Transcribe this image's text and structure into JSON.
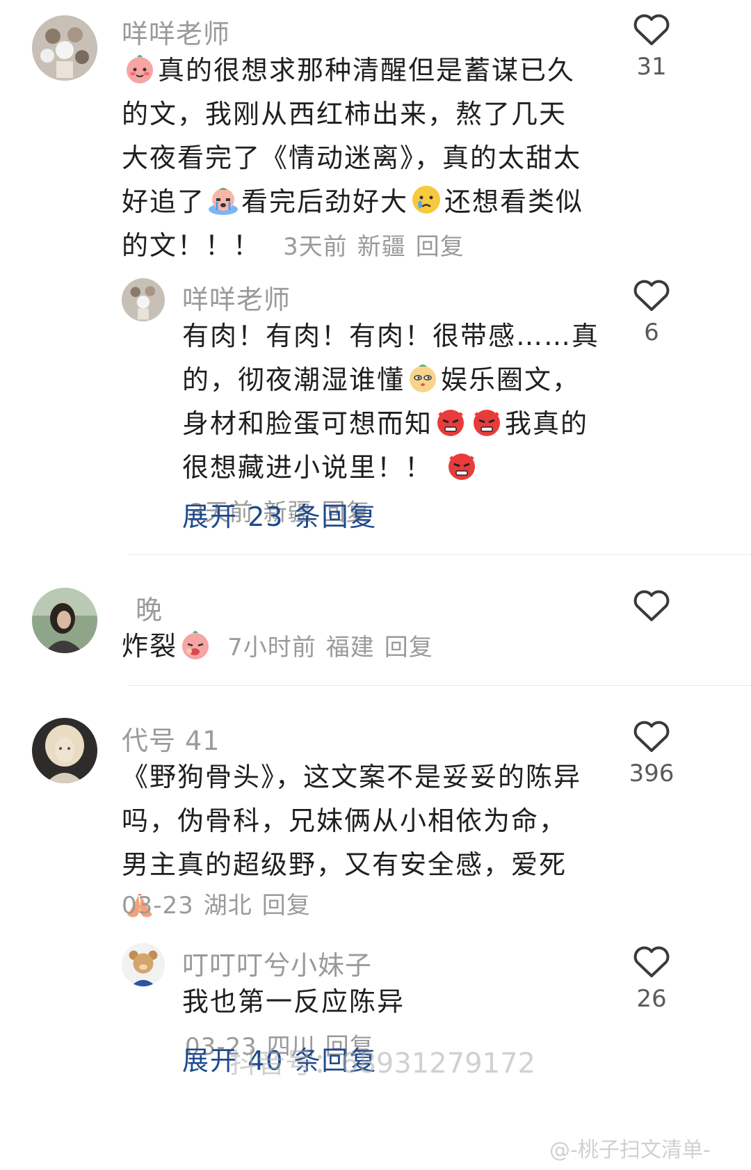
{
  "comments": [
    {
      "author": "咩咩老师",
      "text_parts": [
        "真的很想求那种清醒但是蓄谋已久的文，我刚从西红柿出来，熬了几天大夜看完了《情动迷离》，真的太甜太好追了",
        "看完后劲好大",
        "还想看类似的文！！！"
      ],
      "time": "3天前",
      "location": "新疆",
      "reply": "回复",
      "likes": "31"
    },
    {
      "author": "咩咩老师",
      "text_parts": [
        "有肉！有肉！有肉！很带感……真的，彻夜潮湿谁懂",
        "娱乐圈文，身材和脸蛋可想而知",
        "我真的很想藏进小说里！！"
      ],
      "time": "3天前",
      "location": "新疆",
      "reply": "回复",
      "likes": "6",
      "expand": "展开 23 条回复"
    },
    {
      "author": "晚",
      "text_parts": [
        "炸裂"
      ],
      "time": "7小时前",
      "location": "福建",
      "reply": "回复",
      "likes": ""
    },
    {
      "author": "代号 41",
      "text_parts": [
        "《野狗骨头》，这文案不是妥妥的陈异吗，伪骨科，兄妹俩从小相依为命，男主真的超级野，又有安全感，爱死"
      ],
      "time": "03-23",
      "location": "湖北",
      "reply": "回复",
      "likes": "396"
    },
    {
      "author": "叮叮叮兮小妹子",
      "text_parts": [
        "我也第一反应陈异"
      ],
      "time": "03-23",
      "location": "四川",
      "reply": "回复",
      "likes": "26",
      "expand": "展开 40 条回复"
    }
  ],
  "watermark": {
    "left": "抖音号：68931279172",
    "right": "@-桃子扫文清单-"
  },
  "icons": {
    "like": "heart-outline-icon",
    "emoji_1": "peach-face-emoji",
    "emoji_2": "crying-face-emoji",
    "emoji_3": "sad-face-emoji",
    "emoji_4": "smug-face-emoji",
    "emoji_5": "angry-devil-emoji"
  },
  "colors": {
    "text": "#1f1f1f",
    "meta": "#9a9a9a",
    "link": "#1e4a8c"
  }
}
